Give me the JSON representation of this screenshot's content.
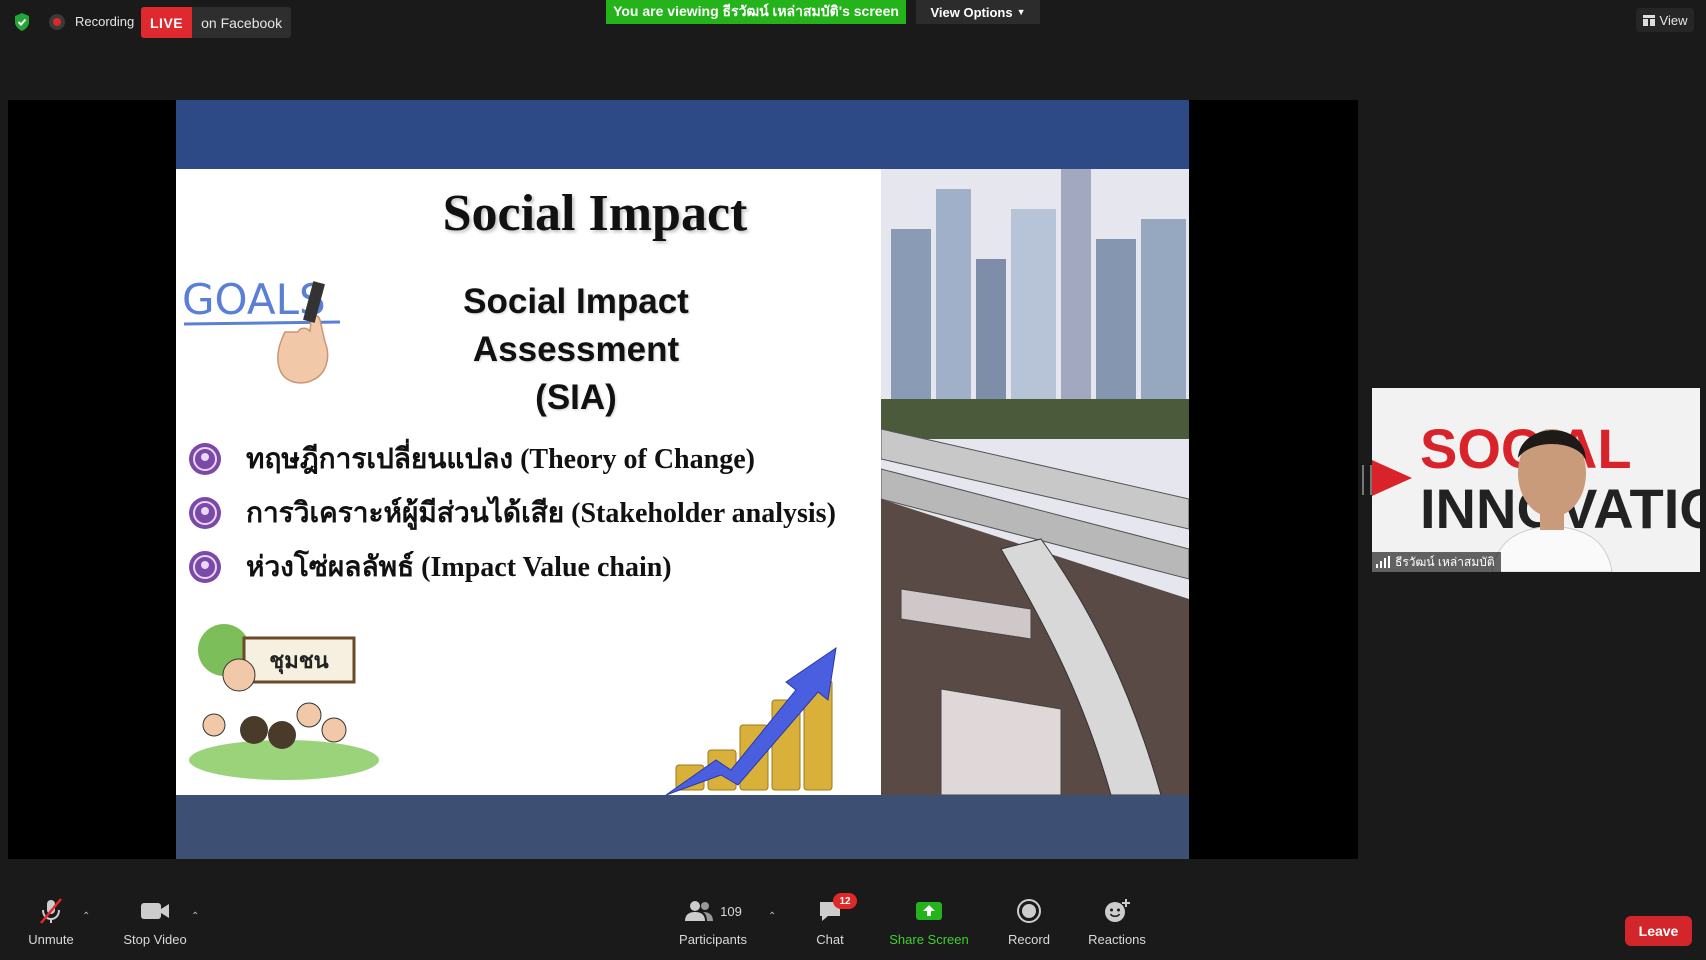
{
  "topbar": {
    "recording_label": "Recording",
    "live_badge": "LIVE",
    "live_destination": "on Facebook",
    "viewing_banner": "You are viewing ธีรวัฒน์ เหล่าสมบัติ's screen",
    "view_options_label": "View Options",
    "view_label": "View"
  },
  "slide": {
    "title": "Social Impact",
    "goals_text": "GOALS",
    "subtitle_line1": "Social Impact Assessment",
    "subtitle_line2": "(SIA)",
    "bullets": [
      "ทฤษฎีการเปลี่ยนแปลง (Theory of Change)",
      "การวิเคราะห์ผู้มีส่วนได้เสีย (Stakeholder analysis)",
      "ห่วงโซ่ผลลัพธ์ (Impact Value chain)"
    ],
    "community_sign": "ชุมชน"
  },
  "video": {
    "participant_name": "ธีรวัฒน์ เหล่าสมบัติ",
    "background_text_line1": "SOCIAL",
    "background_text_line2": "INNOVATIO"
  },
  "toolbar": {
    "unmute_label": "Unmute",
    "stop_video_label": "Stop Video",
    "participants_label": "Participants",
    "participants_count": "109",
    "chat_label": "Chat",
    "chat_badge": "12",
    "share_screen_label": "Share Screen",
    "record_label": "Record",
    "reactions_label": "Reactions",
    "leave_label": "Leave"
  },
  "colors": {
    "live_red": "#e0292f",
    "share_green": "#25b31c",
    "slide_header_blue": "#2e4a86",
    "leave_red": "#d2262b"
  }
}
